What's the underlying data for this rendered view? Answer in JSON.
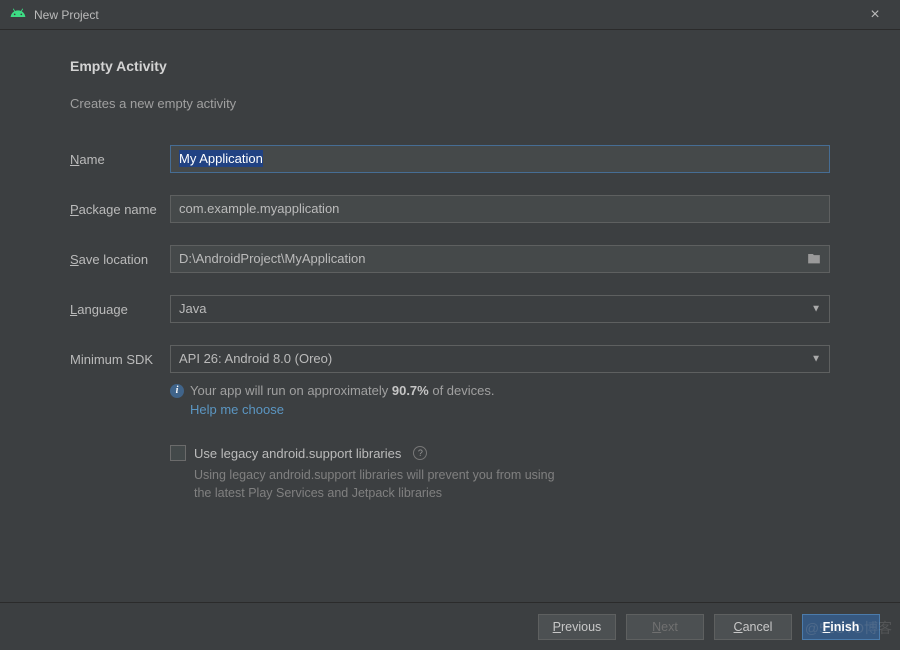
{
  "window": {
    "title": "New Project",
    "close_label": "×"
  },
  "header": {
    "heading": "Empty Activity",
    "subheading": "Creates a new empty activity"
  },
  "form": {
    "name_label": "Name",
    "name_value": "My Application",
    "package_label": "Package name",
    "package_value": "com.example.myapplication",
    "save_label": "Save location",
    "save_value": "D:\\AndroidProject\\MyApplication",
    "language_label": "Language",
    "language_value": "Java",
    "minsdk_label": "Minimum SDK",
    "minsdk_value": "API 26: Android 8.0 (Oreo)"
  },
  "info": {
    "prefix": "Your app will run on approximately ",
    "percent": "90.7%",
    "suffix": " of devices.",
    "help_link": "Help me choose"
  },
  "legacy": {
    "checkbox_label": "Use legacy android.support libraries",
    "desc_line1": "Using legacy android.support libraries will prevent you from using",
    "desc_line2": "the latest Play Services and Jetpack libraries"
  },
  "footer": {
    "previous": "Previous",
    "next": "Next",
    "cancel": "Cancel",
    "finish": "Finish"
  },
  "watermark": "@51CTO博客"
}
